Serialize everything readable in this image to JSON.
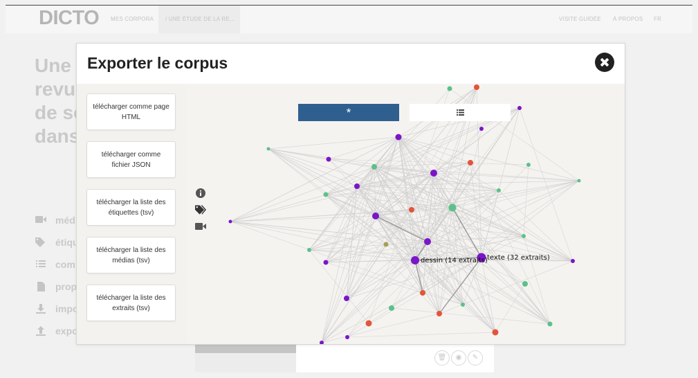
{
  "header": {
    "logo": "DICTO",
    "nav_corpora": "MES CORPORA",
    "nav_breadcrumb": "/ UNE ÉTUDE DE LA RE...",
    "nav_tour": "VISITE GUIDÉE",
    "nav_about": "À PROPOS",
    "nav_lang": "FR"
  },
  "background": {
    "title_lines": [
      "Une",
      "revu",
      "de so",
      "dans"
    ],
    "menu": [
      {
        "label": "méd",
        "icon": "video-icon"
      },
      {
        "label": "étiqu",
        "icon": "tags-icon"
      },
      {
        "label": "com",
        "icon": "list-icon"
      },
      {
        "label": "prop",
        "icon": "file-icon"
      },
      {
        "label": "impo",
        "icon": "download-icon"
      },
      {
        "label": "expo",
        "icon": "upload-icon"
      }
    ]
  },
  "modal": {
    "title": "Exporter le corpus",
    "buttons": [
      "télécharger comme page HTML",
      "télécharger comme fichier JSON",
      "télécharger la liste des étiquettes (tsv)",
      "télécharger la liste des médias (tsv)",
      "télécharger la liste des extraits (tsv)"
    ],
    "tab_star": "*",
    "tab_list_icon": "list-icon",
    "graph_icons": [
      "info-icon",
      "tags-icon",
      "video-icon"
    ]
  },
  "graph": {
    "labels": {
      "texte": "texte (32 extraits)",
      "dessin": "dessin (14 extraits)"
    },
    "colors": {
      "purple": "#7a15c8",
      "green": "#5cc189",
      "red": "#e3543a",
      "olive": "#a6a05a",
      "edge": "#cfcfcf",
      "tab_active": "#2f5f8f"
    }
  }
}
